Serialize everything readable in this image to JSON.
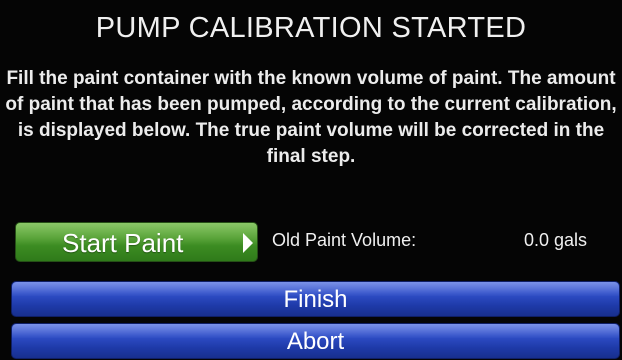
{
  "screen": {
    "title": "PUMP CALIBRATION STARTED",
    "instructions": "Fill the paint container with the known volume of paint. The amount of paint that has been pumped, according to the current calibration, is displayed below. The true paint volume will be corrected in the final step."
  },
  "controls": {
    "start_label": "Start Paint",
    "old_volume_label": "Old Paint Volume:",
    "old_volume_value": "0.0 gals",
    "finish_label": "Finish",
    "abort_label": "Abort"
  },
  "icons": {
    "start_arrow": "chevron-right-icon"
  },
  "colors": {
    "background": "#050505",
    "start_button": "#4a9a2e",
    "action_button": "#2a46bf",
    "text": "#f4f4f4"
  }
}
